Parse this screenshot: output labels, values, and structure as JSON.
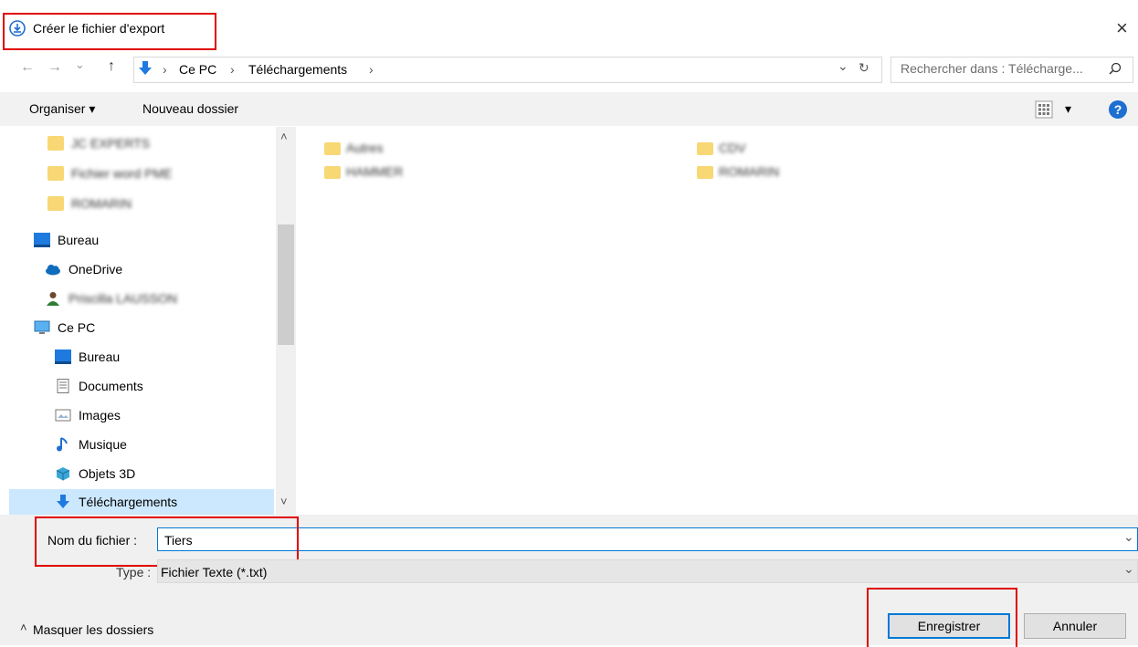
{
  "window": {
    "title": "Créer le fichier d'export",
    "close_glyph": "×",
    "icon": "export-app-icon"
  },
  "address": {
    "back_glyph": "←",
    "forward_glyph": "→",
    "recent_glyph": "⌄",
    "up_glyph": "↑",
    "separator": "›",
    "crumbs": [
      "Ce PC",
      "Téléchargements"
    ],
    "dropdown_glyph": "⌄",
    "refresh_glyph": "↻",
    "search_placeholder": "Rechercher dans : Télécharge...",
    "search_icon": "search-icon"
  },
  "toolbar": {
    "organize_label": "Organiser ▾",
    "new_folder_label": "Nouveau dossier",
    "view_glyph": "▾",
    "help_glyph": "?"
  },
  "nav": {
    "items": [
      {
        "label": "JC EXPERTS",
        "blurred": true,
        "icon": "folder-icon"
      },
      {
        "label": "Fichier word PME",
        "blurred": true,
        "icon": "folder-icon"
      },
      {
        "label": "ROMARIN",
        "blurred": true,
        "icon": "folder-icon"
      },
      {
        "label": "Bureau",
        "blurred": false,
        "icon": "desktop-icon"
      },
      {
        "label": "OneDrive",
        "blurred": false,
        "icon": "cloud-icon"
      },
      {
        "label": "Priscilla LAUSSON",
        "blurred": true,
        "icon": "user-icon"
      },
      {
        "label": "Ce PC",
        "blurred": false,
        "icon": "computer-icon"
      },
      {
        "label": "Bureau",
        "blurred": false,
        "icon": "desktop-icon"
      },
      {
        "label": "Documents",
        "blurred": false,
        "icon": "document-icon"
      },
      {
        "label": "Images",
        "blurred": false,
        "icon": "image-icon"
      },
      {
        "label": "Musique",
        "blurred": false,
        "icon": "music-icon"
      },
      {
        "label": "Objets 3D",
        "blurred": false,
        "icon": "cube-icon"
      },
      {
        "label": "Téléchargements",
        "blurred": false,
        "icon": "download-icon",
        "selected": true
      }
    ],
    "scroll_up": "˄",
    "scroll_down": "˅"
  },
  "content": {
    "folders": [
      {
        "name": "Autres",
        "blurred": true
      },
      {
        "name": "CDV",
        "blurred": true
      },
      {
        "name": "HAMMER",
        "blurred": true
      },
      {
        "name": "ROMARIN",
        "blurred": true
      }
    ]
  },
  "form": {
    "filename_label": "Nom du fichier :",
    "filename_value": "Tiers",
    "type_label": "Type :",
    "type_value": "Fichier Texte (*.txt)",
    "dropdown_glyph": "⌄"
  },
  "footer": {
    "hide_folders_label": "Masquer les dossiers",
    "hide_glyph": "˄",
    "save_label": "Enregistrer",
    "cancel_label": "Annuler"
  },
  "colors": {
    "accent": "#0078d7",
    "highlight_box": "#e00000",
    "selection": "#cce8ff",
    "folder": "#f8d775"
  }
}
